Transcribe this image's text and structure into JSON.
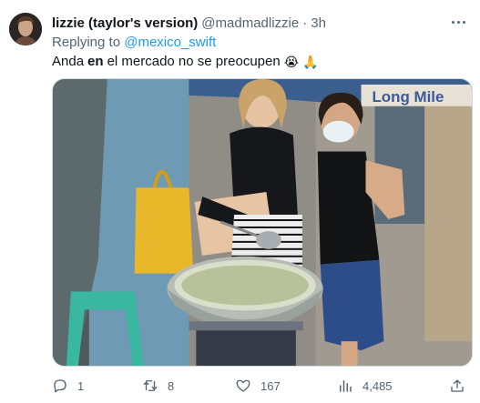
{
  "tweet": {
    "display_name": "lizzie (taylor's version)",
    "handle": "@madmadlizzie",
    "separator": "·",
    "time": "3h",
    "replying_prefix": "Replying to",
    "replying_handle": "@mexico_swift",
    "text_before": "Anda",
    "text_bold": "en",
    "text_after": "el mercado no se preocupen",
    "emoji_1": "😭",
    "emoji_2": "🙏",
    "media_sign_text": "Long Mile"
  },
  "actions": {
    "reply_count": "1",
    "retweet_count": "8",
    "like_count": "167",
    "view_count": "4,485"
  },
  "icons": {
    "reply": "reply-icon",
    "retweet": "retweet-icon",
    "like": "heart-icon",
    "views": "views-icon",
    "share": "share-icon",
    "more": "more-icon"
  },
  "colors": {
    "text": "#0f1419",
    "muted": "#536471",
    "link": "#1d9bf0"
  }
}
